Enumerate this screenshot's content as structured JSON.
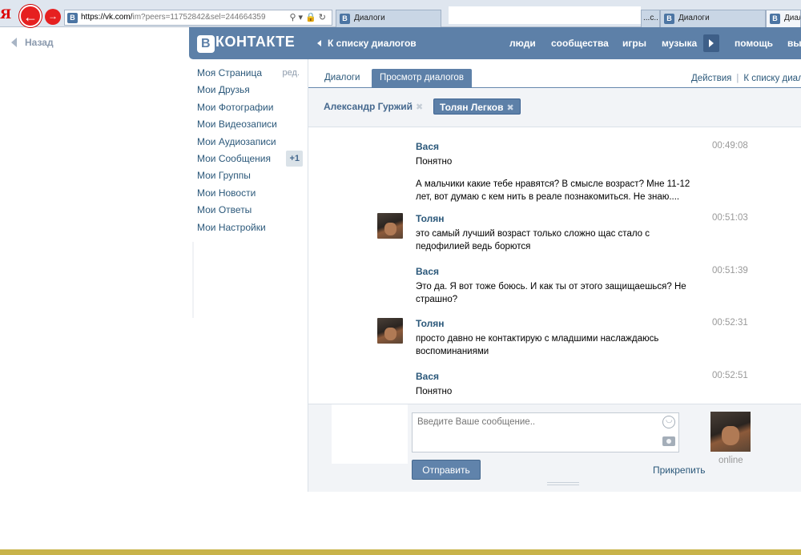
{
  "browser": {
    "yandex_logo": "Я",
    "url_host": "https://vk.com/",
    "url_path": "im?peers=11752842&sel=244664359",
    "favicon": "В",
    "tabs": [
      {
        "label": "Диалоги",
        "active": false
      },
      {
        "label": "...с.. ✕",
        "active": false
      },
      {
        "label": "Диалоги",
        "active": false
      },
      {
        "label": "Диал",
        "active": true
      }
    ]
  },
  "page": {
    "back_label": "Назад"
  },
  "header": {
    "logo_letter": "В",
    "logo_text": "КОНТАКТЕ",
    "to_list": "К списку диалогов",
    "menu": [
      "люди",
      "сообщества",
      "игры",
      "музыка",
      "помощь",
      "вы"
    ]
  },
  "left_menu": {
    "edit_label": "ред.",
    "badge": "+1",
    "items": [
      "Моя Страница",
      "Мои Друзья",
      "Мои Фотографии",
      "Мои Видеозаписи",
      "Мои Аудиозаписи",
      "Мои Сообщения",
      "Мои Группы",
      "Мои Новости",
      "Мои Ответы",
      "Мои Настройки"
    ]
  },
  "tabs": {
    "dialogs": "Диалоги",
    "view": "Просмотр диалогов",
    "actions": "Действия",
    "to_list": "К списку диалогов"
  },
  "peers": [
    {
      "name": "Александр Гуржий",
      "selected": false
    },
    {
      "name": "Толян Легков",
      "selected": true
    }
  ],
  "messages": [
    {
      "author": "Вася",
      "time": "00:49:08",
      "has_avatar": false,
      "lines": [
        "Понятно",
        "А мальчики какие тебе нравятся? В смысле возраст? Мне 11-12 лет, вот думаю с кем нить в реале познакомиться. Не знаю...."
      ]
    },
    {
      "author": "Толян",
      "time": "00:51:03",
      "has_avatar": true,
      "lines": [
        "это самый лучший возраст только сложно щас стало с педофилией ведь борются"
      ]
    },
    {
      "author": "Вася",
      "time": "00:51:39",
      "has_avatar": false,
      "lines": [
        "Это да. Я вот тоже боюсь. И как ты от этого защищаешься? Не страшно?"
      ]
    },
    {
      "author": "Толян",
      "time": "00:52:31",
      "has_avatar": true,
      "lines": [
        "просто давно не контактирую с младшими наслаждаюсь воспоминаниями"
      ]
    },
    {
      "author": "Вася",
      "time": "00:52:51",
      "has_avatar": false,
      "lines": [
        "Понятно"
      ]
    }
  ],
  "compose": {
    "placeholder": "Введите Ваше сообщение..",
    "send": "Отправить",
    "attach": "Прикрепить",
    "status": "online"
  },
  "colors": {
    "vk_blue": "#5d80a8",
    "link": "#2b587a",
    "back_button": "#e62020"
  }
}
